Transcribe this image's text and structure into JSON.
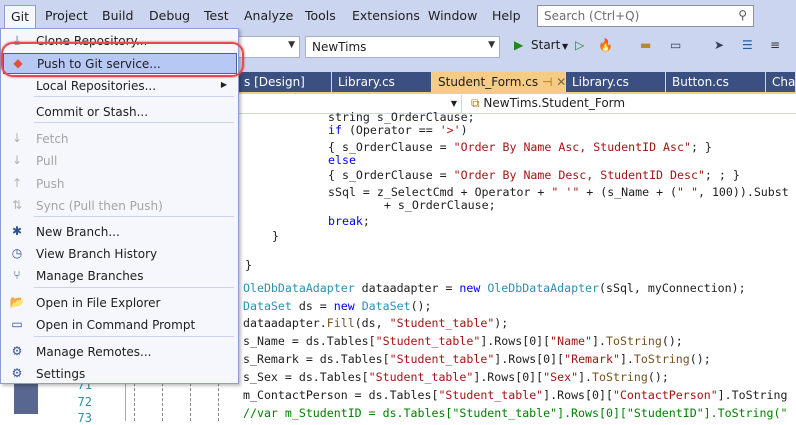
{
  "menubar": {
    "items": [
      "Git",
      "Project",
      "Build",
      "Debug",
      "Test",
      "Analyze",
      "Tools",
      "Extensions",
      "Window",
      "Help"
    ],
    "search_placeholder": "Search (Ctrl+Q)"
  },
  "toolbar": {
    "project_combo": "NewTims",
    "start_label": "Start"
  },
  "tabs": [
    "s [Design]",
    "Library.cs",
    "Student_Form.cs",
    "Library.cs",
    "Button.cs",
    "Cha"
  ],
  "active_tab_pin": "⊣",
  "active_tab_close": "✕",
  "navbar": {
    "class_path": "NewTims.Student_Form"
  },
  "git_menu": {
    "items": [
      {
        "label": "Clone Repository...",
        "icon": "clone-icon",
        "glyph": "⤓",
        "enabled": true
      },
      {
        "label": "Push to Git service...",
        "icon": "git-push-service-icon",
        "glyph": "◆",
        "enabled": true,
        "highlighted": true
      },
      {
        "label": "Local Repositories...",
        "icon": "",
        "glyph": "",
        "enabled": true,
        "submenu": true
      },
      {
        "label": "Commit or Stash...",
        "icon": "",
        "glyph": "",
        "enabled": true
      },
      {
        "label": "Fetch",
        "icon": "fetch-icon",
        "glyph": "↓",
        "enabled": false
      },
      {
        "label": "Pull",
        "icon": "pull-icon",
        "glyph": "↓",
        "enabled": false
      },
      {
        "label": "Push",
        "icon": "push-icon",
        "glyph": "↑",
        "enabled": false
      },
      {
        "label": "Sync (Pull then Push)",
        "icon": "sync-icon",
        "glyph": "⇅",
        "enabled": false
      },
      {
        "label": "New Branch...",
        "icon": "new-branch-icon",
        "glyph": "✱",
        "enabled": true
      },
      {
        "label": "View Branch History",
        "icon": "history-icon",
        "glyph": "◷",
        "enabled": true
      },
      {
        "label": "Manage Branches",
        "icon": "branches-icon",
        "glyph": "⑂",
        "enabled": true
      },
      {
        "label": "Open in File Explorer",
        "icon": "folder-icon",
        "glyph": "📂",
        "enabled": true
      },
      {
        "label": "Open in Command Prompt",
        "icon": "terminal-icon",
        "glyph": "▭",
        "enabled": true
      },
      {
        "label": "Manage Remotes...",
        "icon": "gear-icon",
        "glyph": "⚙",
        "enabled": true
      },
      {
        "label": "Settings",
        "icon": "gear-icon",
        "glyph": "⚙",
        "enabled": true
      }
    ]
  },
  "line_numbers": [
    "71",
    "72",
    "73"
  ],
  "code_lines": [
    [
      [
        "string s_OrderClause;",
        "pl"
      ]
    ],
    [
      [
        "if",
        "kw"
      ],
      [
        " (Operator == ",
        "pl"
      ],
      [
        "'>'",
        "st"
      ],
      [
        ")",
        "pl"
      ]
    ],
    [
      [
        "{ s_OrderClause = ",
        "pl"
      ],
      [
        "\"Order By Name Asc, StudentID Asc\"",
        "st"
      ],
      [
        "; }",
        "pl"
      ]
    ],
    [
      [
        "else",
        "kw"
      ]
    ],
    [
      [
        "{ s_OrderClause = ",
        "pl"
      ],
      [
        "\"Order By Name Desc, StudentID Desc\"",
        "st"
      ],
      [
        "; ; }",
        "pl"
      ]
    ],
    [
      [
        "sSql = z_SelectCmd + Operator + ",
        "pl"
      ],
      [
        "\" '\"",
        "st"
      ],
      [
        " + (s_Name + (",
        "pl"
      ],
      [
        "\" \"",
        "st"
      ],
      [
        ", 100)).Subst",
        "pl"
      ]
    ],
    [
      [
        "    + s_OrderClause;",
        "pl"
      ]
    ],
    [
      [
        "break",
        "kw"
      ],
      [
        ";",
        "pl"
      ]
    ],
    [
      [
        "}",
        "pl"
      ]
    ],
    [
      [
        "}",
        "pl"
      ]
    ],
    [
      [
        "OleDbDataAdapter",
        "ty"
      ],
      [
        " dataadapter = ",
        "pl"
      ],
      [
        "new",
        "kw"
      ],
      [
        " ",
        "pl"
      ],
      [
        "OleDbDataAdapter",
        "ty"
      ],
      [
        "(sSql, myConnection);",
        "pl"
      ]
    ],
    [
      [
        "DataSet",
        "ty"
      ],
      [
        " ds = ",
        "pl"
      ],
      [
        "new",
        "kw"
      ],
      [
        " ",
        "pl"
      ],
      [
        "DataSet",
        "ty"
      ],
      [
        "();",
        "pl"
      ]
    ],
    [
      [
        "dataadapter.",
        "pl"
      ],
      [
        "Fill",
        "me"
      ],
      [
        "(ds, ",
        "pl"
      ],
      [
        "\"Student_table\"",
        "st"
      ],
      [
        ");",
        "pl"
      ]
    ],
    [
      [
        "s_Name = ds.Tables[",
        "pl"
      ],
      [
        "\"Student_table\"",
        "st"
      ],
      [
        "].Rows[0][",
        "pl"
      ],
      [
        "\"Name\"",
        "st"
      ],
      [
        "].",
        "pl"
      ],
      [
        "ToString",
        "me"
      ],
      [
        "();",
        "pl"
      ]
    ],
    [
      [
        "s_Remark = ds.Tables[",
        "pl"
      ],
      [
        "\"Student_table\"",
        "st"
      ],
      [
        "].Rows[0][",
        "pl"
      ],
      [
        "\"Remark\"",
        "st"
      ],
      [
        "].",
        "pl"
      ],
      [
        "ToString",
        "me"
      ],
      [
        "();",
        "pl"
      ]
    ],
    [
      [
        "s_Sex = ds.Tables[",
        "pl"
      ],
      [
        "\"Student_table\"",
        "st"
      ],
      [
        "].Rows[0][",
        "pl"
      ],
      [
        "\"Sex\"",
        "st"
      ],
      [
        "].",
        "pl"
      ],
      [
        "ToString",
        "me"
      ],
      [
        "();",
        "pl"
      ]
    ],
    [
      [
        "m_ContactPerson = ds.Tables[",
        "pl"
      ],
      [
        "\"Student_table\"",
        "st"
      ],
      [
        "].Rows[0][",
        "pl"
      ],
      [
        "\"ContactPerson\"",
        "st"
      ],
      [
        "].ToString",
        "pl"
      ]
    ],
    [
      [
        "//var m_StudentID = ds.Tables[\"Student_table\"].Rows[0][\"StudentID\"].ToString(\"",
        "cm"
      ]
    ]
  ]
}
